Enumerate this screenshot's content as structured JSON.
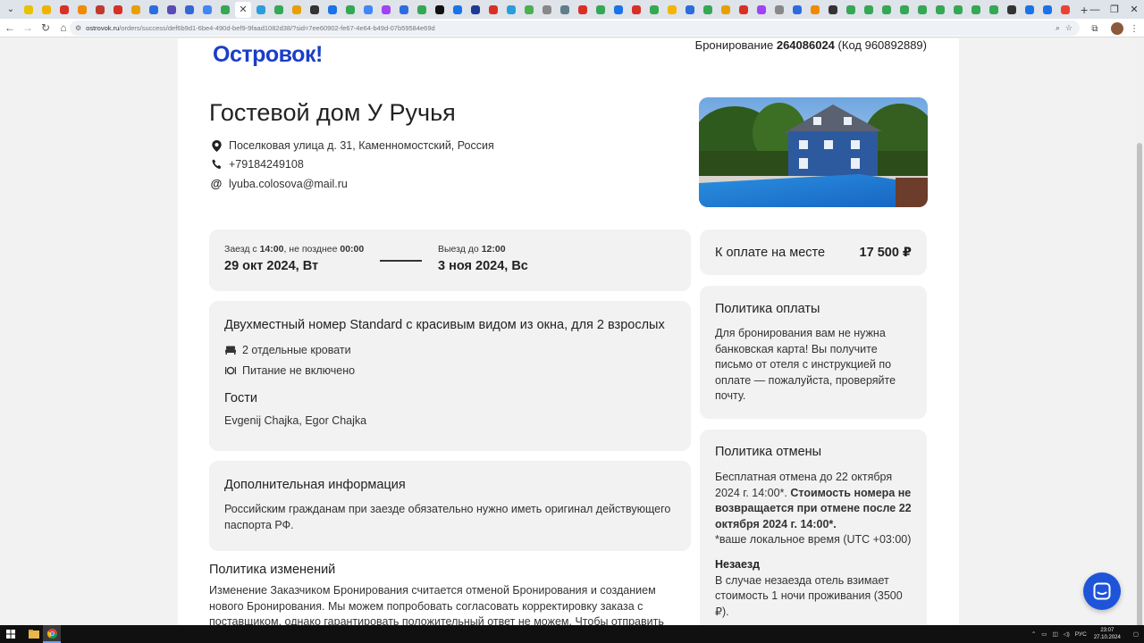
{
  "browser": {
    "url_host": "ostrovok.ru",
    "url_path": "/orders/success/def6b9d1-6be4-490d-bef9-9faad1082d38/?sid=7ee60902-fe67-4e64-b49d-07b59584e69d",
    "tab_colors": [
      "#e8c200",
      "#f0b400",
      "#d93025",
      "#f08a00",
      "#c0392b",
      "#d93025",
      "#e8a000",
      "#2d6cdf",
      "#5b4bb5",
      "#3367d6",
      "#4285f4",
      "#34a853",
      "#ffffff",
      "#2d9cdb",
      "#34a853",
      "#e8a000",
      "#333333",
      "#1a73e8",
      "#34a853",
      "#4285f4",
      "#a142f4",
      "#2d6cdf",
      "#34a853",
      "#111111",
      "#1a73e8",
      "#1f3a93",
      "#d93025",
      "#2d9cdb",
      "#4caf50",
      "#888888",
      "#607d8b",
      "#d93025",
      "#34a853",
      "#1a73e8",
      "#d93025",
      "#34a853",
      "#f4b400",
      "#2d6cdf",
      "#34a853",
      "#e8a000",
      "#d93025",
      "#a142f4",
      "#888888",
      "#2d6cdf",
      "#f08a00",
      "#333333",
      "#34a853",
      "#34a853",
      "#34a853",
      "#34a853",
      "#34a853",
      "#34a853",
      "#34a853",
      "#34a853",
      "#34a853",
      "#333333",
      "#1a73e8",
      "#1a73e8",
      "#ea4335"
    ]
  },
  "header": {
    "logo": "Островок!",
    "booking_label": "Бронирование",
    "booking_number": "264086024",
    "booking_code": "(Код 960892889)"
  },
  "hotel": {
    "name": "Гостевой дом У Ручья",
    "address": "Поселковая улица д. 31, Каменномостский, Россия",
    "phone": "+79184249108",
    "email": "lyuba.colosova@mail.ru"
  },
  "dates": {
    "checkin_label_prefix": "Заезд с",
    "checkin_from": "14:00",
    "checkin_mid": ", не позднее",
    "checkin_until": "00:00",
    "checkin_date": "29 окт 2024, Вт",
    "checkout_label_prefix": "Выезд до",
    "checkout_until": "12:00",
    "checkout_date": "3 ноя 2024, Вс"
  },
  "payment": {
    "label": "К оплате на месте",
    "amount": "17 500 ₽"
  },
  "room": {
    "title": "Двухместный номер Standard с красивым видом из окна, для 2 взрослых",
    "beds": "2 отдельные кровати",
    "meals": "Питание не включено",
    "guests_title": "Гости",
    "guests": "Evgenij Chajka, Egor Chajka"
  },
  "payment_policy": {
    "title": "Политика оплаты",
    "text": "Для бронирования вам не нужна банковская карта! Вы получите письмо от отеля с инструкцией по оплате — пожалуйста, проверяйте почту."
  },
  "extra": {
    "title": "Дополнительная информация",
    "text": "Российским гражданам при заезде обязательно нужно иметь оригинал действующего паспорта РФ."
  },
  "cancel_policy": {
    "title": "Политика отмены",
    "free_text": "Бесплатная отмена до 22 октября 2024 г. 14:00*.",
    "bold_text": "Стоимость номера не возвращается при отмене после 22 октября 2024 г. 14:00*.",
    "timezone": "*ваше локальное время (UTC +03:00)",
    "noshow_title": "Незаезд",
    "noshow_text": "В случае незаезда отель взимает стоимость 1 ночи проживания (3500 ₽)."
  },
  "changes_policy": {
    "title": "Политика изменений",
    "text": "Изменение Заказчиком Бронирования считается отменой Бронирования и созданием нового Бронирования. Мы можем попробовать согласовать корректировку заказа с поставщиком, однако гарантировать положительный ответ не можем. Чтобы отправить запрос на изменение"
  },
  "taskbar": {
    "lang": "РУС",
    "time": "23:07",
    "date": "27.10.2024"
  }
}
